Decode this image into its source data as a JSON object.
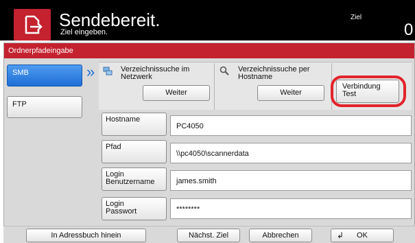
{
  "header": {
    "title": "Sendebereit.",
    "subtitle": "Ziel eingeben.",
    "ziel_label": "Ziel",
    "ziel_count": "0"
  },
  "panel": {
    "title": "Ordnerpfadeingabe"
  },
  "protocols": [
    {
      "label": "SMB",
      "selected": true
    },
    {
      "label": "FTP",
      "selected": false
    }
  ],
  "search_options": [
    {
      "label_line1": "Verzeichnissuche im",
      "label_line2": "Netzwerk",
      "button": "Weiter",
      "icon": "network-icon"
    },
    {
      "label_line1": "Verzeichnissuche per",
      "label_line2": "Hostname",
      "button": "Weiter",
      "icon": "magnifier-icon"
    }
  ],
  "test_button": {
    "line1": "Verbindung",
    "line2": "Test"
  },
  "fields": [
    {
      "label_line1": "Hostname",
      "label_line2": "",
      "value": "PC4050"
    },
    {
      "label_line1": "Pfad",
      "label_line2": "",
      "value": "\\\\pc4050\\scannerdata"
    },
    {
      "label_line1": "Login",
      "label_line2": "Benutzername",
      "value": "james.smith"
    },
    {
      "label_line1": "Login",
      "label_line2": "Passwort",
      "value": "********"
    }
  ],
  "bottom_buttons": {
    "address_book": "In Adressbuch hinein",
    "next_dest": "Nächst. Ziel",
    "cancel": "Abbrechen",
    "ok": "OK"
  },
  "colors": {
    "accent_red": "#c4222f",
    "selected_blue": "#1e6fd6",
    "highlight_ring": "#e2232b"
  }
}
